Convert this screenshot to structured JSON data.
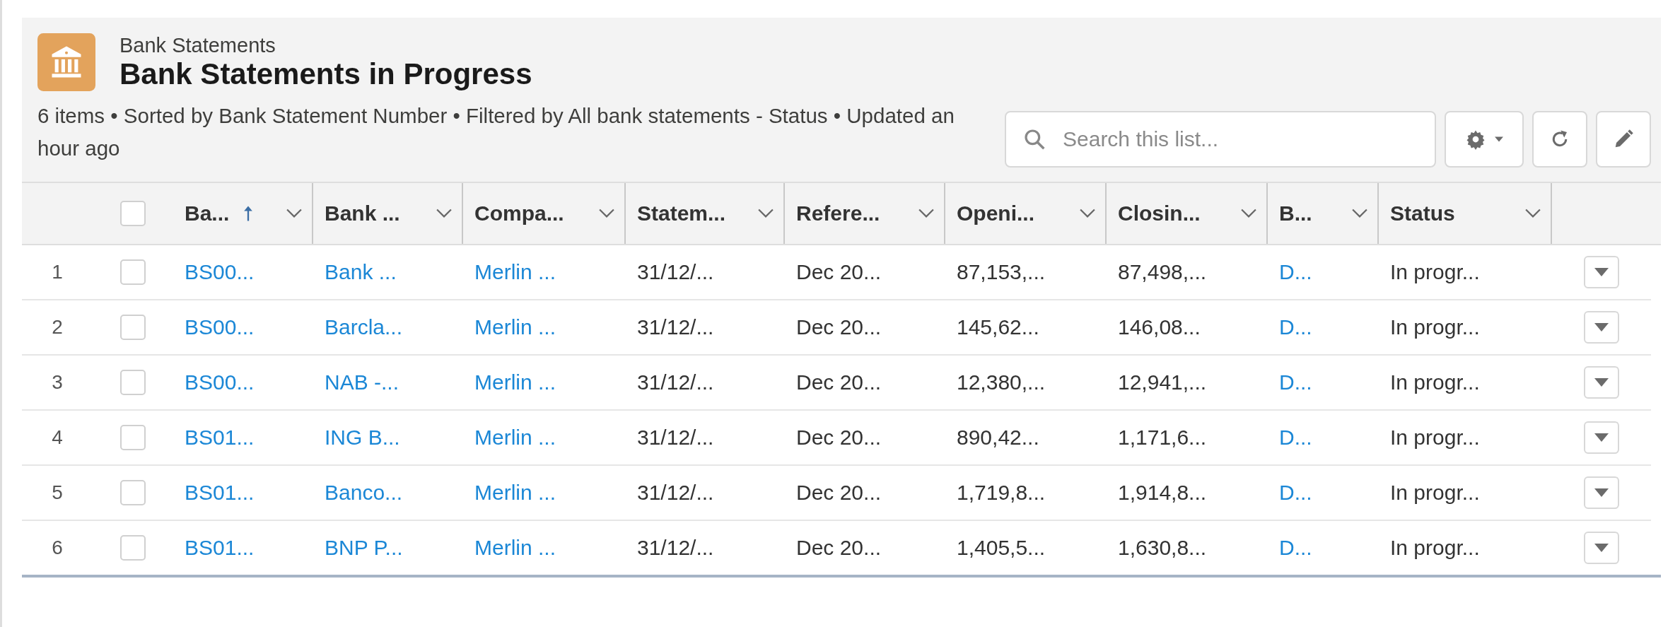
{
  "header": {
    "object_label": "Bank Statements",
    "title": "Bank Statements in Progress",
    "summary": "6 items • Sorted by Bank Statement Number • Filtered by All bank statements - Status • Updated an hour ago"
  },
  "search": {
    "placeholder": "Search this list..."
  },
  "table": {
    "select_all": {
      "checked": false
    },
    "columns": [
      {
        "label": "Ba...",
        "kind": "link",
        "sorted": true
      },
      {
        "label": "Bank ...",
        "kind": "link",
        "sorted": false
      },
      {
        "label": "Compa...",
        "kind": "link",
        "sorted": false
      },
      {
        "label": "Statem...",
        "kind": "text",
        "sorted": false
      },
      {
        "label": "Refere...",
        "kind": "text",
        "sorted": false
      },
      {
        "label": "Openi...",
        "kind": "text",
        "sorted": false
      },
      {
        "label": "Closin...",
        "kind": "text",
        "sorted": false
      },
      {
        "label": "B...",
        "kind": "link",
        "sorted": false
      },
      {
        "label": "Status",
        "kind": "text",
        "sorted": false
      }
    ],
    "rows": [
      {
        "number": "1",
        "checked": false,
        "cells": [
          "BS00...",
          "Bank ...",
          "Merlin ...",
          "31/12/...",
          "Dec 20...",
          "87,153,...",
          "87,498,...",
          "D...",
          "In progr..."
        ]
      },
      {
        "number": "2",
        "checked": false,
        "cells": [
          "BS00...",
          "Barcla...",
          "Merlin ...",
          "31/12/...",
          "Dec 20...",
          "145,62...",
          "146,08...",
          "D...",
          "In progr..."
        ]
      },
      {
        "number": "3",
        "checked": false,
        "cells": [
          "BS00...",
          "NAB -...",
          "Merlin ...",
          "31/12/...",
          "Dec 20...",
          "12,380,...",
          "12,941,...",
          "D...",
          "In progr..."
        ]
      },
      {
        "number": "4",
        "checked": false,
        "cells": [
          "BS01...",
          "ING B...",
          "Merlin ...",
          "31/12/...",
          "Dec 20...",
          "890,42...",
          "1,171,6...",
          "D...",
          "In progr..."
        ]
      },
      {
        "number": "5",
        "checked": false,
        "cells": [
          "BS01...",
          "Banco...",
          "Merlin ...",
          "31/12/...",
          "Dec 20...",
          "1,719,8...",
          "1,914,8...",
          "D...",
          "In progr..."
        ]
      },
      {
        "number": "6",
        "checked": false,
        "cells": [
          "BS01...",
          "BNP P...",
          "Merlin ...",
          "31/12/...",
          "Dec 20...",
          "1,405,5...",
          "1,630,8...",
          "D...",
          "In progr..."
        ]
      }
    ]
  }
}
